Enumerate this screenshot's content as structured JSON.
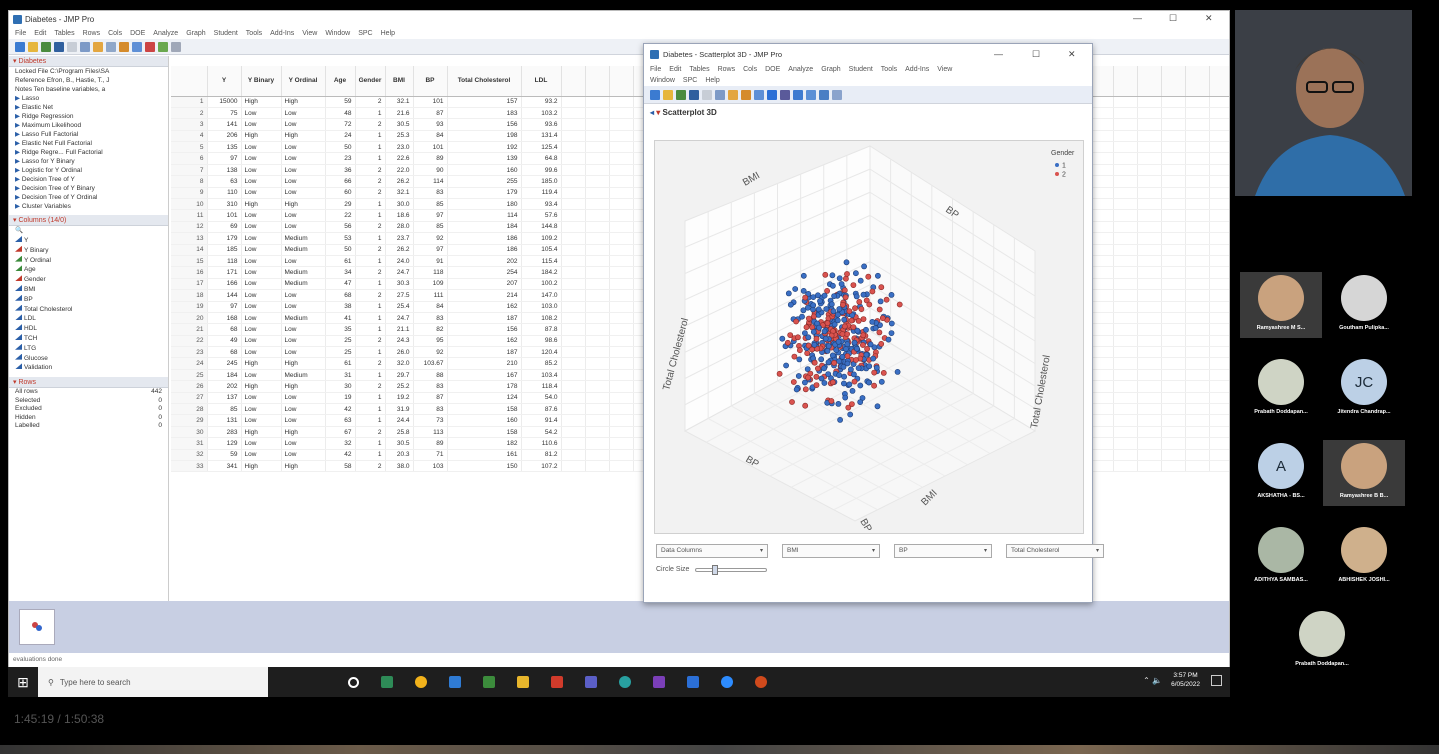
{
  "main_window": {
    "title": "Diabetes - JMP Pro",
    "menu": [
      "File",
      "Edit",
      "Tables",
      "Rows",
      "Cols",
      "DOE",
      "Analyze",
      "Graph",
      "Student",
      "Tools",
      "Add-Ins",
      "View",
      "Window",
      "SPC",
      "Help"
    ]
  },
  "table_panel": {
    "name": "Diabetes",
    "lines": [
      "Locked File C:\\Program Files\\SA",
      "Reference Efron, B., Hastie, T., J",
      "Notes Ten baseline variables, a"
    ],
    "scripts": [
      "Lasso",
      "Elastic Net",
      "Ridge Regression",
      "Maximum Likelihood",
      "Lasso Full Factorial",
      "Elastic Net Full Factorial",
      "Ridge Regre... Full Factorial",
      "Lasso for Y Binary",
      "Logistic for Y Ordinal",
      "Decision Tree of Y",
      "Decision Tree of Y Binary",
      "Decision Tree of Y Ordinal",
      "Cluster Variables"
    ]
  },
  "columns_panel": {
    "header": "Columns (14/0)",
    "items": [
      "Y",
      "Y Binary",
      "Y Ordinal",
      "Age",
      "Gender",
      "BMI",
      "BP",
      "Total Cholesterol",
      "LDL",
      "HDL",
      "TCH",
      "LTG",
      "Glucose",
      "Validation"
    ]
  },
  "rows_panel": {
    "header": "Rows",
    "items": [
      {
        "label": "All rows",
        "value": "442"
      },
      {
        "label": "Selected",
        "value": "0"
      },
      {
        "label": "Excluded",
        "value": "0"
      },
      {
        "label": "Hidden",
        "value": "0"
      },
      {
        "label": "Labelled",
        "value": "0"
      }
    ]
  },
  "grid": {
    "headers": [
      "",
      "Y",
      "Y Binary",
      "Y Ordinal",
      "Age",
      "Gender",
      "BMI",
      "BP",
      "Total Cholesterol",
      "LDL"
    ],
    "rows": [
      [
        "1",
        "15000",
        "High",
        "High",
        "59",
        "2",
        "32.1",
        "101",
        "157",
        "93.2"
      ],
      [
        "2",
        "75",
        "Low",
        "Low",
        "48",
        "1",
        "21.6",
        "87",
        "183",
        "103.2"
      ],
      [
        "3",
        "141",
        "Low",
        "Low",
        "72",
        "2",
        "30.5",
        "93",
        "156",
        "93.6"
      ],
      [
        "4",
        "206",
        "High",
        "High",
        "24",
        "1",
        "25.3",
        "84",
        "198",
        "131.4"
      ],
      [
        "5",
        "135",
        "Low",
        "Low",
        "50",
        "1",
        "23.0",
        "101",
        "192",
        "125.4"
      ],
      [
        "6",
        "97",
        "Low",
        "Low",
        "23",
        "1",
        "22.6",
        "89",
        "139",
        "64.8"
      ],
      [
        "7",
        "138",
        "Low",
        "Low",
        "36",
        "2",
        "22.0",
        "90",
        "160",
        "99.6"
      ],
      [
        "8",
        "63",
        "Low",
        "Low",
        "66",
        "2",
        "26.2",
        "114",
        "255",
        "185.0"
      ],
      [
        "9",
        "110",
        "Low",
        "Low",
        "60",
        "2",
        "32.1",
        "83",
        "179",
        "119.4"
      ],
      [
        "10",
        "310",
        "High",
        "High",
        "29",
        "1",
        "30.0",
        "85",
        "180",
        "93.4"
      ],
      [
        "11",
        "101",
        "Low",
        "Low",
        "22",
        "1",
        "18.6",
        "97",
        "114",
        "57.6"
      ],
      [
        "12",
        "69",
        "Low",
        "Low",
        "56",
        "2",
        "28.0",
        "85",
        "184",
        "144.8"
      ],
      [
        "13",
        "179",
        "Low",
        "Medium",
        "53",
        "1",
        "23.7",
        "92",
        "186",
        "109.2"
      ],
      [
        "14",
        "185",
        "Low",
        "Medium",
        "50",
        "2",
        "26.2",
        "97",
        "186",
        "105.4"
      ],
      [
        "15",
        "118",
        "Low",
        "Low",
        "61",
        "1",
        "24.0",
        "91",
        "202",
        "115.4"
      ],
      [
        "16",
        "171",
        "Low",
        "Medium",
        "34",
        "2",
        "24.7",
        "118",
        "254",
        "184.2"
      ],
      [
        "17",
        "166",
        "Low",
        "Medium",
        "47",
        "1",
        "30.3",
        "109",
        "207",
        "100.2"
      ],
      [
        "18",
        "144",
        "Low",
        "Low",
        "68",
        "2",
        "27.5",
        "111",
        "214",
        "147.0"
      ],
      [
        "19",
        "97",
        "Low",
        "Low",
        "38",
        "1",
        "25.4",
        "84",
        "162",
        "103.0"
      ],
      [
        "20",
        "168",
        "Low",
        "Medium",
        "41",
        "1",
        "24.7",
        "83",
        "187",
        "108.2"
      ],
      [
        "21",
        "68",
        "Low",
        "Low",
        "35",
        "1",
        "21.1",
        "82",
        "156",
        "87.8"
      ],
      [
        "22",
        "49",
        "Low",
        "Low",
        "25",
        "2",
        "24.3",
        "95",
        "162",
        "98.6"
      ],
      [
        "23",
        "68",
        "Low",
        "Low",
        "25",
        "1",
        "26.0",
        "92",
        "187",
        "120.4"
      ],
      [
        "24",
        "245",
        "High",
        "High",
        "61",
        "2",
        "32.0",
        "103.67",
        "210",
        "85.2"
      ],
      [
        "25",
        "184",
        "Low",
        "Medium",
        "31",
        "1",
        "29.7",
        "88",
        "167",
        "103.4"
      ],
      [
        "26",
        "202",
        "High",
        "High",
        "30",
        "2",
        "25.2",
        "83",
        "178",
        "118.4"
      ],
      [
        "27",
        "137",
        "Low",
        "Low",
        "19",
        "1",
        "19.2",
        "87",
        "124",
        "54.0"
      ],
      [
        "28",
        "85",
        "Low",
        "Low",
        "42",
        "1",
        "31.9",
        "83",
        "158",
        "87.6"
      ],
      [
        "29",
        "131",
        "Low",
        "Low",
        "63",
        "1",
        "24.4",
        "73",
        "160",
        "91.4"
      ],
      [
        "30",
        "283",
        "High",
        "High",
        "67",
        "2",
        "25.8",
        "113",
        "158",
        "54.2"
      ],
      [
        "31",
        "129",
        "Low",
        "Low",
        "32",
        "1",
        "30.5",
        "89",
        "182",
        "110.6"
      ],
      [
        "32",
        "59",
        "Low",
        "Low",
        "42",
        "1",
        "20.3",
        "71",
        "161",
        "81.2"
      ],
      [
        "33",
        "341",
        "High",
        "High",
        "58",
        "2",
        "38.0",
        "103",
        "150",
        "107.2"
      ]
    ]
  },
  "status": "evaluations done",
  "scatter_window": {
    "title": "Diabetes - Scatterplot 3D - JMP Pro",
    "menu_line1": [
      "File",
      "Edit",
      "Tables",
      "Rows",
      "Cols",
      "DOE",
      "Analyze",
      "Graph",
      "Student",
      "Tools",
      "Add-Ins",
      "View"
    ],
    "menu_line2": [
      "Window",
      "SPC",
      "Help"
    ],
    "outline_title": "Scatterplot 3D",
    "legend_title": "Gender",
    "legend_items": [
      {
        "label": "1",
        "color": "#3a6fc4"
      },
      {
        "label": "2",
        "color": "#d9534f"
      }
    ],
    "axis_labels": {
      "bmi": "BMI",
      "bp": "BP",
      "tc_left": "Total Cholesterol",
      "tc_right": "Total Cholesterol"
    },
    "dropdowns": [
      "Data Columns",
      "BMI",
      "BP",
      "Total Cholesterol"
    ],
    "circle_size_label": "Circle Size"
  },
  "taskbar": {
    "search_placeholder": "Type here to search",
    "time": "3:57 PM",
    "date": "6/05/2022"
  },
  "participants": [
    {
      "name": "Ramyashree M S...",
      "initials": "",
      "color": "#c9a27e",
      "highlight": true
    },
    {
      "name": "Goutham Pulipka...",
      "initials": "",
      "color": "#d6d6d6",
      "highlight": false
    },
    {
      "name": "Prabath Doddapan...",
      "initials": "",
      "color": "#cfd4c5",
      "highlight": false
    },
    {
      "name": "Jitendra Chandrap...",
      "initials": "JC",
      "color": "#bcd0e6",
      "highlight": false
    },
    {
      "name": "AKSHATHA - BS...",
      "initials": "A",
      "color": "#bcd0e6",
      "highlight": false
    },
    {
      "name": "Ramyashree B B...",
      "initials": "",
      "color": "#c9a27e",
      "highlight": true
    },
    {
      "name": "ADITHYA SAMBAS...",
      "initials": "",
      "color": "#aab7a5",
      "highlight": false
    },
    {
      "name": "ABHISHEK JOSHI...",
      "initials": "",
      "color": "#cfb08c",
      "highlight": false
    },
    {
      "name": "Prabath Doddapan...",
      "initials": "",
      "color": "#cfd4c5",
      "highlight": false
    }
  ],
  "video_timer": "1:45:19 / 1:50:38"
}
